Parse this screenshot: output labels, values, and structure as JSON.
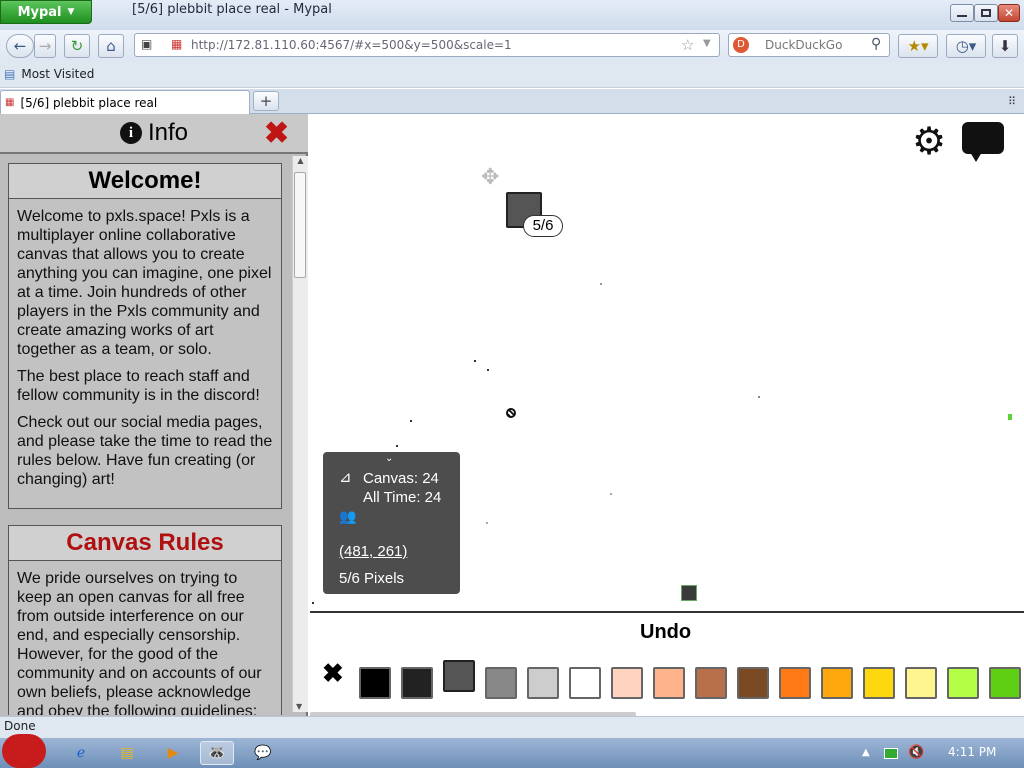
{
  "window": {
    "app_button": "Mypal",
    "title": "[5/6] plebbit place real - Mypal"
  },
  "nav": {
    "url": "http://172.81.110.60:4567/#x=500&y=500&scale=1",
    "search_placeholder": "DuckDuckGo"
  },
  "bookmarks": {
    "item": "Most Visited"
  },
  "tab": {
    "label": "[5/6] plebbit place real",
    "new_tab": "+"
  },
  "info": {
    "title": "Info",
    "close": "✖",
    "welcome": {
      "heading": "Welcome!",
      "p1": "Welcome to pxls.space! Pxls is a multiplayer online collaborative canvas that allows you to create anything you can imagine, one pixel at a time. Join hundreds of other players in the Pxls community and create amazing works of art together as a team, or solo.",
      "p2": "The best place to reach staff and fellow community is in the discord!",
      "p3": "Check out our social media pages, and please take the time to read the rules below. Have fun creating (or changing) art!"
    },
    "rules": {
      "heading": "Canvas Rules",
      "heading_color": "#b01010",
      "p1": "We pride ourselves on trying to keep an open canvas for all free from outside interference on our end, and especially censorship. However, for the good of the community and on accounts of our own beliefs, please acknowledge and obey the following guidelines:"
    }
  },
  "canvas": {
    "cursor_count": "5/6",
    "stats": {
      "canvas": "Canvas: 24",
      "all_time": "All Time: 24",
      "coords": "(481, 261)",
      "pixels": "5/6 Pixels"
    }
  },
  "palette": {
    "undo": "Undo",
    "close": "✖",
    "colors": [
      "#000000",
      "#222222",
      "#555555",
      "#888888",
      "#cdcdcd",
      "#ffffff",
      "#ffd3c0",
      "#ffb38a",
      "#b8704a",
      "#7a4a24",
      "#ff7a14",
      "#ffa80e",
      "#ffd70e",
      "#fff58f",
      "#b4ff45",
      "#5fcf14"
    ],
    "selected_index": 2
  },
  "statusbar": {
    "text": "Done"
  },
  "taskbar": {
    "time": "4:11 PM"
  }
}
